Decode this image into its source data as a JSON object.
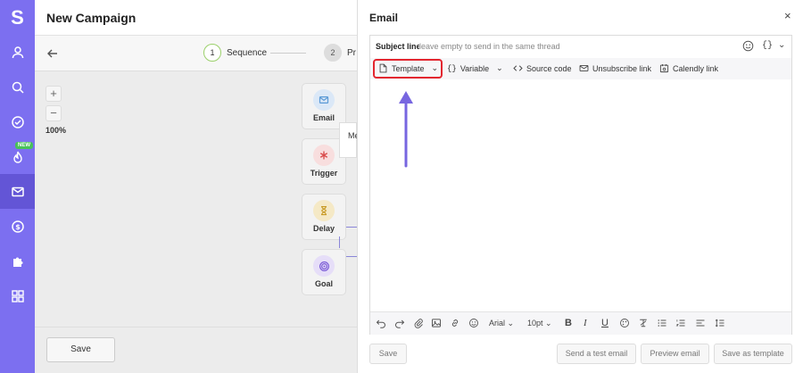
{
  "app": {
    "logo_letter": "S",
    "new_badge": "NEW"
  },
  "sidebar": {
    "items": [
      {
        "icon": "user-icon"
      },
      {
        "icon": "search-icon"
      },
      {
        "icon": "check-circle-icon"
      },
      {
        "icon": "flame-icon"
      },
      {
        "icon": "mail-icon",
        "active": true
      },
      {
        "icon": "dollar-icon"
      },
      {
        "icon": "puzzle-icon"
      },
      {
        "icon": "apps-grid-icon"
      }
    ]
  },
  "campaign": {
    "title": "New Campaign",
    "steps": [
      {
        "number": "1",
        "label": "Sequence"
      },
      {
        "number": "2",
        "label": "Pr"
      }
    ],
    "zoom_in": "+",
    "zoom_out": "−",
    "zoom_level": "100%",
    "nodes": [
      {
        "label": "Email",
        "icon": "mail-icon",
        "color": "#5b9ad6",
        "bg": "#dbe8f7"
      },
      {
        "label": "Trigger",
        "icon": "asterisk-icon",
        "color": "#d94b4b",
        "bg": "#f8dede"
      },
      {
        "label": "Delay",
        "icon": "hourglass-icon",
        "color": "#c89a24",
        "bg": "#f5e9c6"
      },
      {
        "label": "Goal",
        "icon": "target-icon",
        "color": "#7a5bd6",
        "bg": "#e6def8"
      }
    ],
    "mini_card_text": "Me",
    "save_label": "Save"
  },
  "modal": {
    "title": "Email",
    "close": "×",
    "subject_label": "Subject line:",
    "subject_placeholder": "leave empty to send in the same thread",
    "variable_glyph": "{}",
    "toolbar": {
      "template": "Template",
      "variable": "Variable",
      "source_code": "Source code",
      "unsubscribe": "Unsubscribe link",
      "calendly": "Calendly link"
    },
    "format": {
      "font": "Arial",
      "size": "10pt"
    },
    "footer": {
      "save": "Save",
      "send_test": "Send a test email",
      "preview": "Preview email",
      "save_template": "Save as template"
    }
  },
  "colors": {
    "sidebar": "#7c6ff0",
    "highlight": "#e3262f",
    "arrow": "#7766e0"
  }
}
